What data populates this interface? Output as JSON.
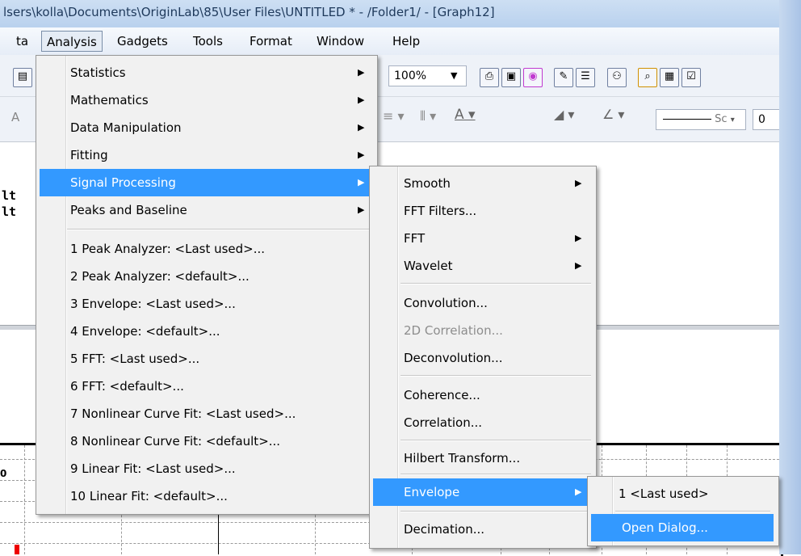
{
  "window": {
    "title": "lsers\\kolla\\Documents\\OriginLab\\85\\User Files\\UNTITLED * - /Folder1/ - [Graph12]"
  },
  "menubar": {
    "items": [
      "ta",
      "Analysis",
      "Gadgets",
      "Tools",
      "Format",
      "Window",
      "Help"
    ],
    "active": "Analysis"
  },
  "toolbar": {
    "zoom_value": "100%",
    "font_size_value": "0",
    "line_style_label": "Sc",
    "left_glyph": "A"
  },
  "workspace": {
    "text_line1": "lt",
    "text_line2": "lt",
    "axis_label": "0"
  },
  "analysis_menu": {
    "items": [
      {
        "label": "Statistics",
        "mnemonic": "S",
        "submenu": true
      },
      {
        "label": "Mathematics",
        "mnemonic": "M",
        "submenu": true
      },
      {
        "label": "Data Manipulation",
        "mnemonic": "D",
        "submenu": true
      },
      {
        "label": "Fitting",
        "mnemonic": "F",
        "submenu": true
      },
      {
        "label": "Signal Processing",
        "mnemonic": "P",
        "submenu": true,
        "highlighted": true
      },
      {
        "label": "Peaks and Baseline",
        "mnemonic": "B",
        "submenu": true
      },
      {
        "label": "1 Peak Analyzer: <Last used>...",
        "mnemonic": "1"
      },
      {
        "label": "2 Peak Analyzer: <default>...",
        "mnemonic": "2"
      },
      {
        "label": "3 Envelope: <Last used>...",
        "mnemonic": "3"
      },
      {
        "label": "4 Envelope: <default>...",
        "mnemonic": "4"
      },
      {
        "label": "5 FFT: <Last used>...",
        "mnemonic": "5"
      },
      {
        "label": "6 FFT: <default>...",
        "mnemonic": "6"
      },
      {
        "label": "7 Nonlinear Curve Fit: <Last used>...",
        "mnemonic": "7"
      },
      {
        "label": "8 Nonlinear Curve Fit: <default>...",
        "mnemonic": "8"
      },
      {
        "label": "9 Linear Fit: <Last used>...",
        "mnemonic": "9"
      },
      {
        "label": "10 Linear Fit: <default>...",
        "mnemonic": "10"
      }
    ]
  },
  "signal_processing_menu": {
    "items": [
      {
        "label": "Smooth",
        "submenu": true
      },
      {
        "label": "FFT Filters..."
      },
      {
        "label": "FFT",
        "submenu": true
      },
      {
        "label": "Wavelet",
        "submenu": true
      },
      {
        "label": "Convolution..."
      },
      {
        "label": "2D Correlation...",
        "disabled": true
      },
      {
        "label": "Deconvolution..."
      },
      {
        "label": "Coherence..."
      },
      {
        "label": "Correlation..."
      },
      {
        "label": "Hilbert Transform..."
      },
      {
        "label": "Envelope",
        "submenu": true,
        "highlighted": true
      },
      {
        "label": "Decimation..."
      }
    ]
  },
  "envelope_menu": {
    "items": [
      {
        "label": "1 <Last used>"
      },
      {
        "label": "Open Dialog...",
        "highlighted": true
      }
    ]
  }
}
